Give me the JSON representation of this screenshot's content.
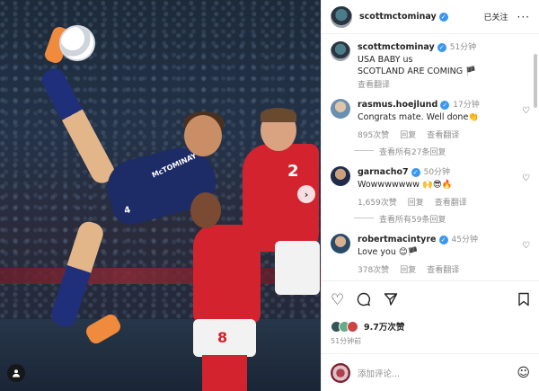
{
  "post": {
    "author": "scottmctominay",
    "follow_status": "已关注",
    "more_icon": "more-horizontal-icon",
    "caption_time": "51分钟",
    "caption_line1": "USA BABY us",
    "caption_line2": "SCOTLAND ARE COMING",
    "caption_translate": "查看翻译"
  },
  "photo": {
    "jersey_name": "McTOMINAY",
    "jersey_number_blue": "4",
    "jersey_number_red1": "2",
    "jersey_number_red2": "8"
  },
  "comments": [
    {
      "user": "rasmus.hoejlund",
      "time": "17分钟",
      "text": "Congrats mate. Well done👏",
      "likes": "895次赞",
      "reply": "回复",
      "translate": "查看翻译",
      "replies": "查看所有27条回复"
    },
    {
      "user": "garnacho7",
      "time": "50分钟",
      "text": "Wowwwwwww 🙌😎🔥",
      "likes": "1,659次赞",
      "reply": "回复",
      "translate": "查看翻译",
      "replies": "查看所有59条回复"
    },
    {
      "user": "robertmacintyre",
      "time": "45分钟",
      "text": "Love you 😊🏴",
      "likes": "378次赞",
      "reply": "回复",
      "translate": "查看翻译"
    }
  ],
  "actions": {
    "likes_count": "9.7万次赞",
    "post_time": "51分钟前"
  },
  "composer": {
    "placeholder": "添加评论..."
  }
}
